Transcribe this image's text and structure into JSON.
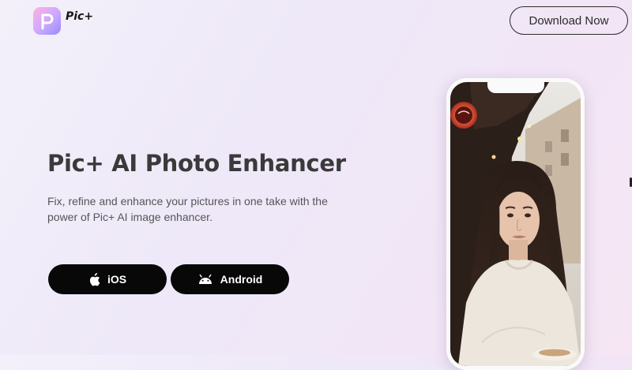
{
  "brand": {
    "name": "Pic+",
    "logo_icon": "pic-plus-logo-icon",
    "accent": "#c9a8ff"
  },
  "header": {
    "download_label": "Download Now"
  },
  "hero": {
    "title": "Pic+ AI Photo Enhancer",
    "subtitle": "Fix, refine and enhance your pictures in one take with the power of Pic+ AI image enhancer."
  },
  "store_buttons": [
    {
      "label": "iOS",
      "icon": "apple-icon"
    },
    {
      "label": "Android",
      "icon": "android-icon"
    }
  ],
  "colors": {
    "button_bg": "#080808",
    "title": "#3a3a3a",
    "text": "#555555"
  }
}
